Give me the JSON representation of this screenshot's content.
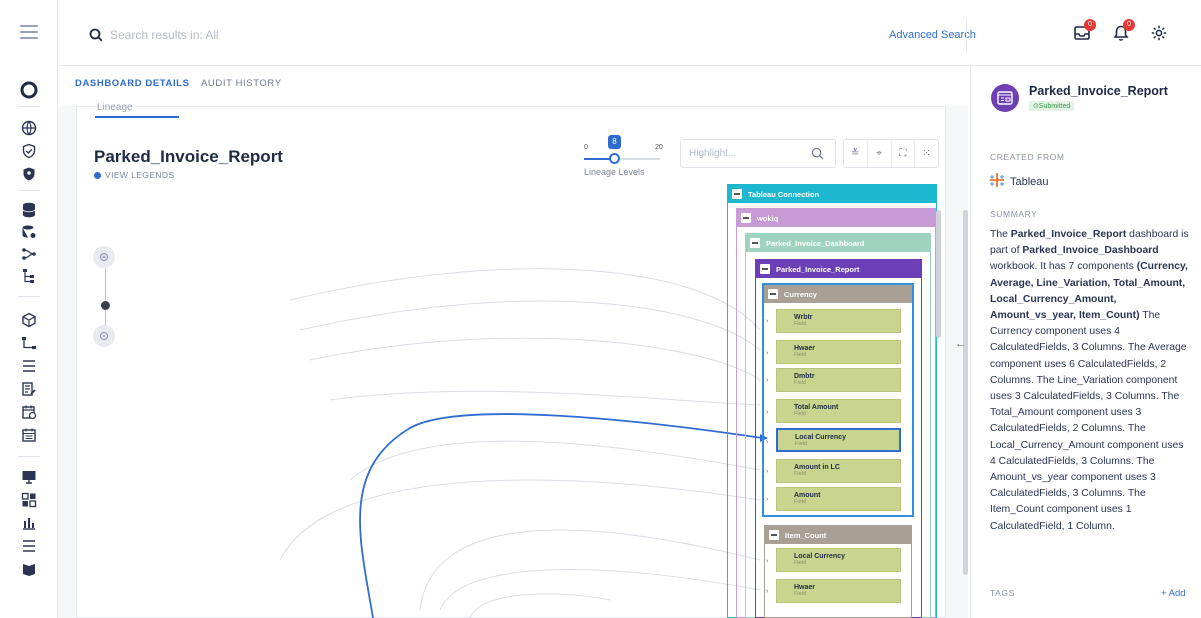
{
  "topbar": {
    "search_placeholder": "Search results in: All",
    "advanced_search": "Advanced Search",
    "notif_badge_1": "0",
    "notif_badge_2": "0"
  },
  "tabs": [
    {
      "label": "DASHBOARD DETAILS"
    },
    {
      "label": "AUDIT HISTORY"
    }
  ],
  "panel": {
    "inner_tab": "Lineage",
    "title": "Parked_Invoice_Report",
    "view_legends": "VIEW LEGENDS",
    "slider_min": "0",
    "slider_max": "20",
    "slider_value": "8",
    "slider_label": "Lineage Levels",
    "highlight_placeholder": "Highlight..."
  },
  "lineage": {
    "tableau_connection": "Tableau Connection",
    "workspace": "wokiq",
    "dashboard": "Parked_Invoice_Dashboard",
    "report": "Parked_Invoice_Report",
    "currency": "Currency",
    "currency_fields": [
      {
        "name": "Wrbtr",
        "type": "Field"
      },
      {
        "name": "Hwaer",
        "type": "Field"
      },
      {
        "name": "Dmbtr",
        "type": "Field"
      },
      {
        "name": "Total Amount",
        "type": "Field"
      },
      {
        "name": "Local Currency",
        "type": "Field"
      },
      {
        "name": "Amount in LC",
        "type": "Field"
      },
      {
        "name": "Amount",
        "type": "Field"
      }
    ],
    "item_count": "Item_Count",
    "item_count_fields": [
      {
        "name": "Local Currency",
        "type": "Field"
      },
      {
        "name": "Hwaer",
        "type": "Field"
      }
    ]
  },
  "sidebar": {
    "title": "Parked_Invoice_Report",
    "status": "Submitted",
    "created_from_label": "CREATED FROM",
    "created_from": "Tableau",
    "summary_label": "SUMMARY",
    "tags_label": "TAGS",
    "add_tag": "+ Add",
    "summary": {
      "s1": "The ",
      "b1": "Parked_Invoice_Report",
      "s2": " dashboard is part of ",
      "b2": "Parked_Invoice_Dashboard",
      "s3": " workbook. It has 7 components ",
      "b3": "(Currency, Average, Line_Variation, Total_Amount, Local_Currency_Amount, Amount_vs_year, Item_Count)",
      "s4": " The Currency component uses 4 CalculatedFields, 3 Columns. The Average component uses 6 CalculatedFields, 2 Columns. The Line_Variation component uses 3 CalculatedFields, 3 Columns. The Total_Amount component uses 3 CalculatedFields, 2 Columns. The Local_Currency_Amount component uses 4 CalculatedFields, 3 Columns. The Amount_vs_year component uses 3 CalculatedFields, 3 Columns. The Item_Count component uses 1 CalculatedField, 1 Column."
    }
  },
  "colors": {
    "accent": "#2f6cd1",
    "tableau_connection": "#1db8d0",
    "workspace": "#c79bd6",
    "dashboard": "#9ed3c0",
    "report": "#6c3fb6",
    "currency": "#a8a095",
    "field": "#c9d48f"
  }
}
